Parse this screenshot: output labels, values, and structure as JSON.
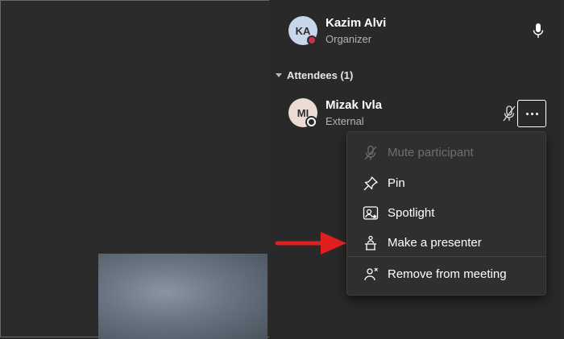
{
  "organizer": {
    "initials": "KA",
    "name": "Kazim Alvi",
    "role": "Organizer",
    "status": "busy"
  },
  "attendees_header": "Attendees (1)",
  "attendee": {
    "initials": "MI",
    "name": "Mizak Ivla",
    "role": "External",
    "status": "offline",
    "mic": "muted"
  },
  "menu": {
    "items": [
      {
        "label": "Mute participant",
        "icon": "mic-off-icon",
        "enabled": false
      },
      {
        "label": "Pin",
        "icon": "pin-icon",
        "enabled": true
      },
      {
        "label": "Spotlight",
        "icon": "spotlight-icon",
        "enabled": true
      },
      {
        "label": "Make a presenter",
        "icon": "presenter-icon",
        "enabled": true
      },
      {
        "label": "Remove from meeting",
        "icon": "remove-person-icon",
        "enabled": true
      }
    ]
  },
  "colors": {
    "background": "#2b2b2b",
    "busy": "#c4314b",
    "annotation_arrow": "#e02020",
    "organizer_avatar": "#c7d6ea",
    "attendee_avatar": "#ecdcd4"
  }
}
